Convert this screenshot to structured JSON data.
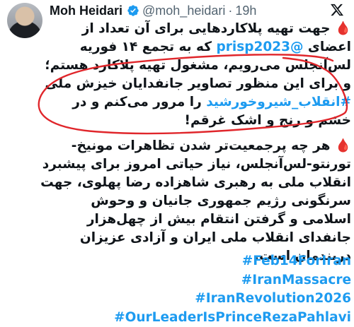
{
  "author": {
    "name": "Moh Heidari",
    "handle": "@moh_heidari",
    "separator": "·",
    "time": "19h"
  },
  "icons": {
    "verified": "verified-badge-icon",
    "platform": "x-logo-icon",
    "bullet": "blood-drop-emoji"
  },
  "colors": {
    "link": "#1d9bf0",
    "verified": "#1d9bf0",
    "annotation": "#e0262b",
    "drop": "#d4162e"
  },
  "tweet": {
    "p1": {
      "drop": "🩸",
      "before_mention": "جهت تهیه پلاکاردهایی برای آن تعداد از اعضای ",
      "mention": "@prisp2023",
      "between": " که به تجمع ۱۴ فوریه لس‌آنجلس می‌رویم، مشغول تهیه پلاکارد هستم؛ و برای این منظور تصاویر جانفدایان خیزش ملی ",
      "hashtag": "#انقلاب_شیروخورشید",
      "after_hashtag": " را مرور می‌کنم و در خشم و رنج و اشک غرقم!"
    },
    "p2": {
      "drop": "🩸",
      "text": "هر چه پرجمعیت‌تر شدن تظاهرات مونیخ-تورنتو-لس‌آنجلس، نیاز حیاتی امروز برای پیشبرد انقلاب ملی به رهبری شاهزاده رضا پهلوی، جهت سرنگونی رژیم جمهوری جانیان و وحوش اسلامی و گرفتن انتقام بیش از چهل‌هزار جانفدای انقلاب ملی ایران و آزادی عزیزان دربندمان است."
    },
    "hashtags": [
      "#Feb14ForIran",
      "#IranMassacre",
      "#IranRevolution2026",
      "#OurLeaderIsPrinceRezaPahlavi"
    ]
  }
}
